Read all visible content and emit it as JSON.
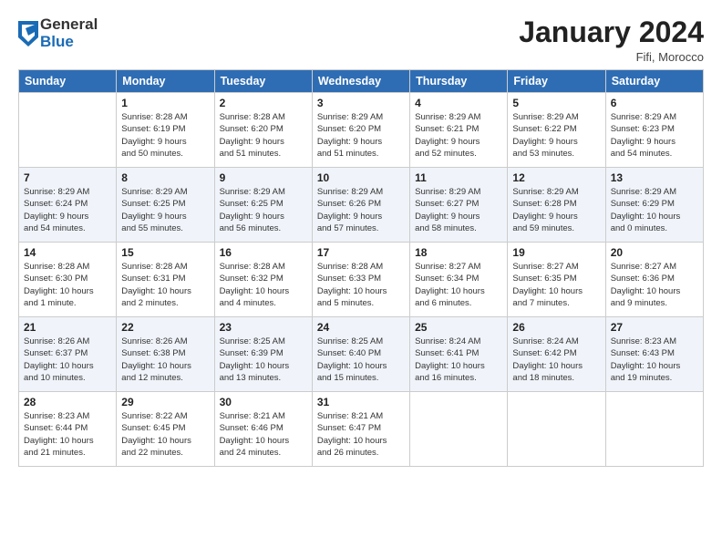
{
  "logo": {
    "general": "General",
    "blue": "Blue"
  },
  "title": "January 2024",
  "location": "Fifi, Morocco",
  "days_header": [
    "Sunday",
    "Monday",
    "Tuesday",
    "Wednesday",
    "Thursday",
    "Friday",
    "Saturday"
  ],
  "weeks": [
    [
      {
        "day": "",
        "info": ""
      },
      {
        "day": "1",
        "info": "Sunrise: 8:28 AM\nSunset: 6:19 PM\nDaylight: 9 hours\nand 50 minutes."
      },
      {
        "day": "2",
        "info": "Sunrise: 8:28 AM\nSunset: 6:20 PM\nDaylight: 9 hours\nand 51 minutes."
      },
      {
        "day": "3",
        "info": "Sunrise: 8:29 AM\nSunset: 6:20 PM\nDaylight: 9 hours\nand 51 minutes."
      },
      {
        "day": "4",
        "info": "Sunrise: 8:29 AM\nSunset: 6:21 PM\nDaylight: 9 hours\nand 52 minutes."
      },
      {
        "day": "5",
        "info": "Sunrise: 8:29 AM\nSunset: 6:22 PM\nDaylight: 9 hours\nand 53 minutes."
      },
      {
        "day": "6",
        "info": "Sunrise: 8:29 AM\nSunset: 6:23 PM\nDaylight: 9 hours\nand 54 minutes."
      }
    ],
    [
      {
        "day": "7",
        "info": "Sunrise: 8:29 AM\nSunset: 6:24 PM\nDaylight: 9 hours\nand 54 minutes."
      },
      {
        "day": "8",
        "info": "Sunrise: 8:29 AM\nSunset: 6:25 PM\nDaylight: 9 hours\nand 55 minutes."
      },
      {
        "day": "9",
        "info": "Sunrise: 8:29 AM\nSunset: 6:25 PM\nDaylight: 9 hours\nand 56 minutes."
      },
      {
        "day": "10",
        "info": "Sunrise: 8:29 AM\nSunset: 6:26 PM\nDaylight: 9 hours\nand 57 minutes."
      },
      {
        "day": "11",
        "info": "Sunrise: 8:29 AM\nSunset: 6:27 PM\nDaylight: 9 hours\nand 58 minutes."
      },
      {
        "day": "12",
        "info": "Sunrise: 8:29 AM\nSunset: 6:28 PM\nDaylight: 9 hours\nand 59 minutes."
      },
      {
        "day": "13",
        "info": "Sunrise: 8:29 AM\nSunset: 6:29 PM\nDaylight: 10 hours\nand 0 minutes."
      }
    ],
    [
      {
        "day": "14",
        "info": "Sunrise: 8:28 AM\nSunset: 6:30 PM\nDaylight: 10 hours\nand 1 minute."
      },
      {
        "day": "15",
        "info": "Sunrise: 8:28 AM\nSunset: 6:31 PM\nDaylight: 10 hours\nand 2 minutes."
      },
      {
        "day": "16",
        "info": "Sunrise: 8:28 AM\nSunset: 6:32 PM\nDaylight: 10 hours\nand 4 minutes."
      },
      {
        "day": "17",
        "info": "Sunrise: 8:28 AM\nSunset: 6:33 PM\nDaylight: 10 hours\nand 5 minutes."
      },
      {
        "day": "18",
        "info": "Sunrise: 8:27 AM\nSunset: 6:34 PM\nDaylight: 10 hours\nand 6 minutes."
      },
      {
        "day": "19",
        "info": "Sunrise: 8:27 AM\nSunset: 6:35 PM\nDaylight: 10 hours\nand 7 minutes."
      },
      {
        "day": "20",
        "info": "Sunrise: 8:27 AM\nSunset: 6:36 PM\nDaylight: 10 hours\nand 9 minutes."
      }
    ],
    [
      {
        "day": "21",
        "info": "Sunrise: 8:26 AM\nSunset: 6:37 PM\nDaylight: 10 hours\nand 10 minutes."
      },
      {
        "day": "22",
        "info": "Sunrise: 8:26 AM\nSunset: 6:38 PM\nDaylight: 10 hours\nand 12 minutes."
      },
      {
        "day": "23",
        "info": "Sunrise: 8:25 AM\nSunset: 6:39 PM\nDaylight: 10 hours\nand 13 minutes."
      },
      {
        "day": "24",
        "info": "Sunrise: 8:25 AM\nSunset: 6:40 PM\nDaylight: 10 hours\nand 15 minutes."
      },
      {
        "day": "25",
        "info": "Sunrise: 8:24 AM\nSunset: 6:41 PM\nDaylight: 10 hours\nand 16 minutes."
      },
      {
        "day": "26",
        "info": "Sunrise: 8:24 AM\nSunset: 6:42 PM\nDaylight: 10 hours\nand 18 minutes."
      },
      {
        "day": "27",
        "info": "Sunrise: 8:23 AM\nSunset: 6:43 PM\nDaylight: 10 hours\nand 19 minutes."
      }
    ],
    [
      {
        "day": "28",
        "info": "Sunrise: 8:23 AM\nSunset: 6:44 PM\nDaylight: 10 hours\nand 21 minutes."
      },
      {
        "day": "29",
        "info": "Sunrise: 8:22 AM\nSunset: 6:45 PM\nDaylight: 10 hours\nand 22 minutes."
      },
      {
        "day": "30",
        "info": "Sunrise: 8:21 AM\nSunset: 6:46 PM\nDaylight: 10 hours\nand 24 minutes."
      },
      {
        "day": "31",
        "info": "Sunrise: 8:21 AM\nSunset: 6:47 PM\nDaylight: 10 hours\nand 26 minutes."
      },
      {
        "day": "",
        "info": ""
      },
      {
        "day": "",
        "info": ""
      },
      {
        "day": "",
        "info": ""
      }
    ]
  ]
}
